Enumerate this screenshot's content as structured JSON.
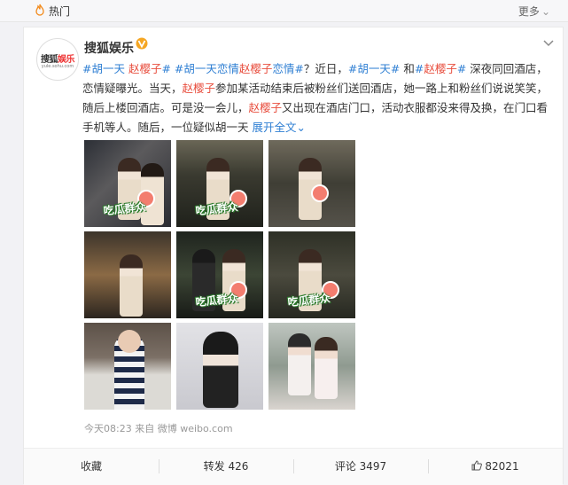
{
  "topbar": {
    "title": "热门",
    "more": "更多",
    "more_icon": "chevron-down-icon",
    "fire_icon": "fire-icon"
  },
  "post": {
    "author": "搜狐娱乐",
    "verified_icon": "verified-badge-icon",
    "avatar": {
      "line1": "搜狐",
      "line1_accent": "娱乐",
      "line2": "yule.sohu.com"
    },
    "text": {
      "t1": "#胡一天 ",
      "n1": "赵樱子",
      "t2": "# #胡一天恋情",
      "n2": "赵樱子",
      "t3": "恋情#",
      "p1": "？近日，",
      "t4": "#胡一天#",
      "p2": " 和",
      "t5": "#",
      "n3": "赵樱子",
      "t6": "#",
      "p3": " 深夜同回酒店，恋情疑曝光。当天，",
      "n4": "赵樱子",
      "p4": "参加某活动结束后被粉丝们送回酒店，她一路上和粉丝们说说笑笑，随后上楼回酒店。可是没一会儿，",
      "n5": "赵樱子",
      "p5": "又出现在酒店门口，活动衣服都没来得及换，在门口看手机等人。随后，一位疑似胡一天",
      "expand": "展开全文"
    },
    "photos": [
      {
        "name": "photo-1",
        "sticker": "吃瓜群众"
      },
      {
        "name": "photo-2",
        "sticker": "吃瓜群众"
      },
      {
        "name": "photo-3",
        "sticker": ""
      },
      {
        "name": "photo-4",
        "sticker": ""
      },
      {
        "name": "photo-5",
        "sticker": "吃瓜群众"
      },
      {
        "name": "photo-6",
        "sticker": "吃瓜群众"
      },
      {
        "name": "photo-7",
        "sticker": ""
      },
      {
        "name": "photo-8",
        "sticker": ""
      },
      {
        "name": "photo-9",
        "sticker": ""
      }
    ],
    "timestamp": "今天08:23",
    "source_prefix": "来自",
    "source": "微博 weibo.com"
  },
  "actions": {
    "favorite": "收藏",
    "repost": "转发 426",
    "comment": "评论 3497",
    "like": "82021",
    "like_icon": "thumbs-up-icon"
  },
  "colors": {
    "topic": "#2f7fd3",
    "name": "#e84d3d",
    "verified": "#f5a623"
  }
}
